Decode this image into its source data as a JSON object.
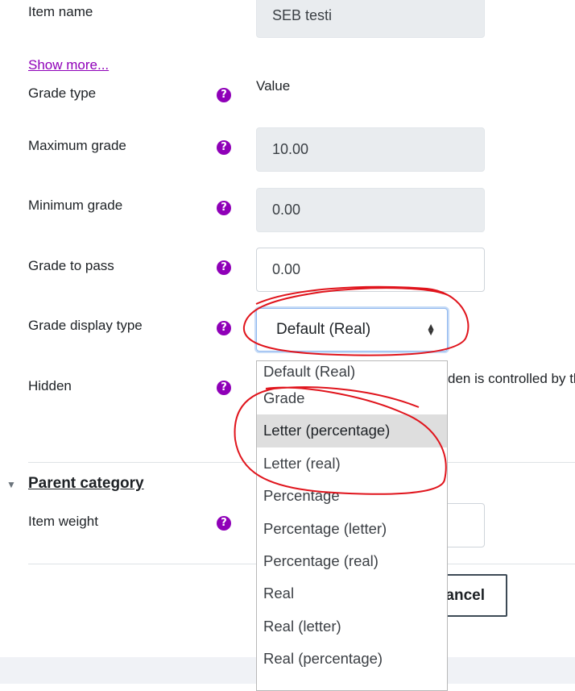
{
  "form": {
    "item_name": {
      "label": "Item name",
      "value": "SEB testi"
    },
    "show_more": "Show more...",
    "grade_type": {
      "label": "Grade type",
      "value": "Value"
    },
    "max_grade": {
      "label": "Maximum grade",
      "value": "10.00"
    },
    "min_grade": {
      "label": "Minimum grade",
      "value": "0.00"
    },
    "grade_to_pass": {
      "label": "Grade to pass",
      "value": "0.00"
    },
    "display_type": {
      "label": "Grade display type",
      "value": "Default (Real)"
    },
    "hidden": {
      "label": "Hidden",
      "note": "den is controlled by th"
    },
    "parent_category": "Parent category",
    "item_weight": {
      "label": "Item weight"
    },
    "cancel_button": "ancel"
  },
  "dropdown_options": [
    "Default (Real)",
    "Grade",
    "Letter (percentage)",
    "Letter (real)",
    "Percentage",
    "Percentage (letter)",
    "Percentage (real)",
    "Real",
    "Real (letter)",
    "Real (percentage)"
  ],
  "icons": {
    "help": "?",
    "collapse": "▼",
    "select_caret_up": "▲",
    "select_caret_down": "▼"
  },
  "colors": {
    "help_icon": "#8f00b8",
    "link": "#8f00b8",
    "annotation": "#e0141c",
    "focus_border": "#90b8ef"
  }
}
